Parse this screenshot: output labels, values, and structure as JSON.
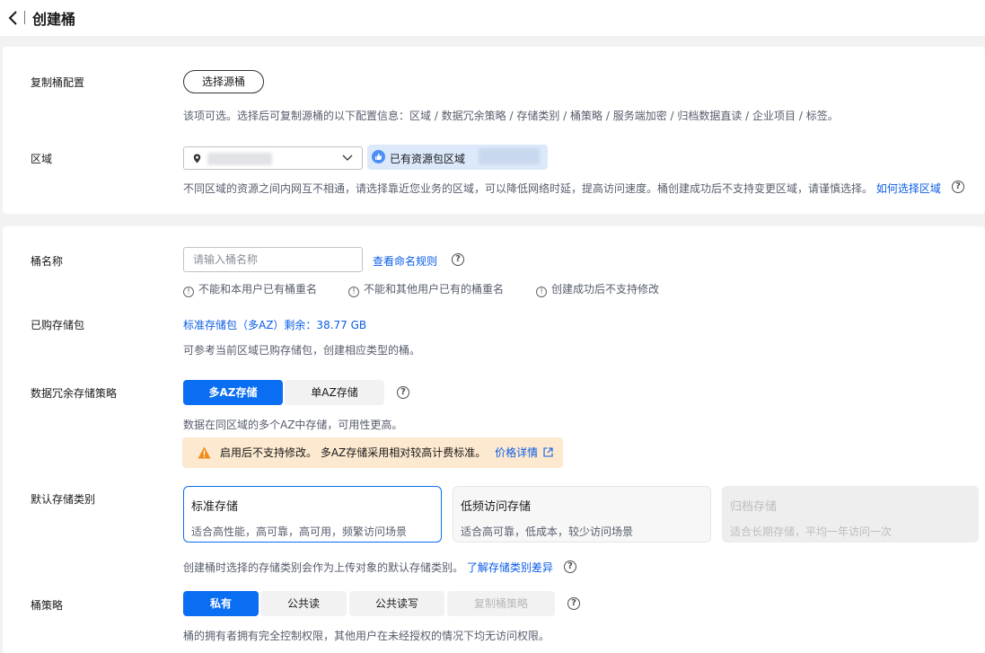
{
  "header": {
    "title": "创建桶"
  },
  "replicate": {
    "label": "复制桶配置",
    "button": "选择源桶",
    "desc": "该项可选。选择后可复制源桶的以下配置信息：区域 / 数据冗余策略 / 存储类别 / 桶策略 / 服务端加密 / 归档数据直读 / 企业项目 / 标签。"
  },
  "region": {
    "label": "区域",
    "badge": "已有资源包区域",
    "desc": "不同区域的资源之间内网互不相通，请选择靠近您业务的区域，可以降低网络时延，提高访问速度。桶创建成功后不支持变更区域，请谨慎选择。",
    "link": "如何选择区域"
  },
  "bucket_name": {
    "label": "桶名称",
    "placeholder": "请输入桶名称",
    "link": "查看命名规则",
    "rules": [
      "不能和本用户已有桶重名",
      "不能和其他用户已有的桶重名",
      "创建成功后不支持修改"
    ]
  },
  "package": {
    "label": "已购存储包",
    "value": "标准存储包（多AZ）剩余：38.77 GB",
    "desc": "可参考当前区域已购存储包，创建相应类型的桶。"
  },
  "redundancy": {
    "label": "数据冗余存储策略",
    "options": [
      "多AZ存储",
      "单AZ存储"
    ],
    "desc": "数据在同区域的多个AZ中存储，可用性更高。",
    "alert": "启用后不支持修改。 多AZ存储采用相对较高计费标准。",
    "alert_link": "价格详情"
  },
  "storage_class": {
    "label": "默认存储类别",
    "cards": [
      {
        "title": "标准存储",
        "desc": "适合高性能，高可靠，高可用，频繁访问场景"
      },
      {
        "title": "低频访问存储",
        "desc": "适合高可靠，低成本，较少访问场景"
      },
      {
        "title": "归档存储",
        "desc": "适合长期存储，平均一年访问一次"
      }
    ],
    "desc": "创建桶时选择的存储类别会作为上传对象的默认存储类别。",
    "link": "了解存储类别差异"
  },
  "policy": {
    "label": "桶策略",
    "options": [
      "私有",
      "公共读",
      "公共读写",
      "复制桶策略"
    ],
    "desc": "桶的拥有者拥有完全控制权限，其他用户在未经授权的情况下均无访问权限。"
  },
  "colors": {
    "primary": "#0a6ef2",
    "link": "#0a5ce6",
    "warning_bg": "#fde9cf",
    "warning_icon": "#f08d1a"
  }
}
